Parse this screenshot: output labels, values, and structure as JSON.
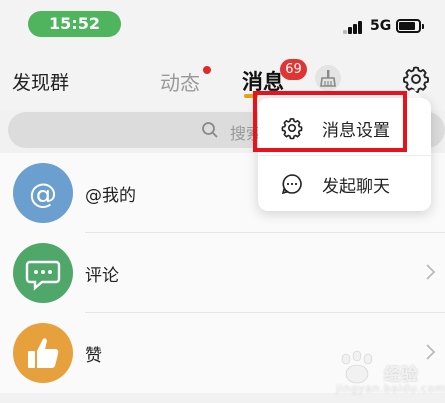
{
  "status_bar": {
    "time": "15:52",
    "network": "5G"
  },
  "header": {
    "discover_label": "发现群",
    "tabs": [
      {
        "label": "动态"
      },
      {
        "label": "消息",
        "badge": "69"
      }
    ]
  },
  "search": {
    "placeholder": "搜索"
  },
  "list": [
    {
      "label": "@我的",
      "icon": "at-icon",
      "color": "#6a9fd0"
    },
    {
      "label": "评论",
      "icon": "comment-icon",
      "color": "#4fa76a"
    },
    {
      "label": "赞",
      "icon": "thumbs-up-icon",
      "color": "#e6a13c"
    }
  ],
  "popup_menu": {
    "items": [
      {
        "label": "消息设置",
        "icon": "gear-icon"
      },
      {
        "label": "发起聊天",
        "icon": "chat-bubble-icon"
      }
    ]
  },
  "watermark": {
    "text": "经验",
    "sub": "jingyan.baidu.com"
  },
  "colors": {
    "time_pill": "#4fb45e",
    "badge": "#e03434",
    "tab_underline": "#e8a01c",
    "highlight_box": "#e8121c"
  }
}
